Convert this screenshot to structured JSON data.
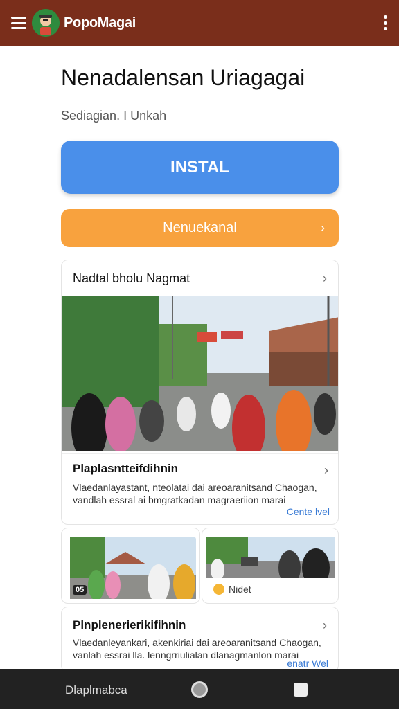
{
  "appbar": {
    "title": "PopoMagai",
    "menu_icon": "hamburger-menu-icon",
    "more_icon": "more-vertical-icon",
    "background": "#7a2e1b"
  },
  "header": {
    "title": "Nenadalensan Uriagagai",
    "subtitle": "Sediagian. I Unkah"
  },
  "actions": {
    "install_label": "INSTAL",
    "install_color": "#4a8fea",
    "secondary_label": "Nenuekanal",
    "secondary_color": "#f8a23e"
  },
  "main_card": {
    "heading": "Nadtal bholu Nagmat",
    "info_title": "Plaplasntteifdihnin",
    "info_desc_line1": "Vlaedanlayastant, nteolatai dai areoaranitsand Chaogan,",
    "info_desc_line2": "vandlah essral ai bmgratkadan magraeriion marai",
    "link": "Cente lvel"
  },
  "small_cards": {
    "left_badge": "05",
    "right_label": "Nidet"
  },
  "bottom_card": {
    "info_title": "Plnplenerierikifihnin",
    "info_desc_line1": "Vlaedanleyankari, akenkiriai dai areoaranitsand Chaogan,",
    "info_desc_line2": "vanlah essrai lla. lenngrriulialan dlanagmanlon marai",
    "link": "enatr Wel"
  },
  "navbar": {
    "label": "Dlaplmabca",
    "home_icon": "home-circle-icon",
    "recent_icon": "recent-apps-square-icon"
  }
}
